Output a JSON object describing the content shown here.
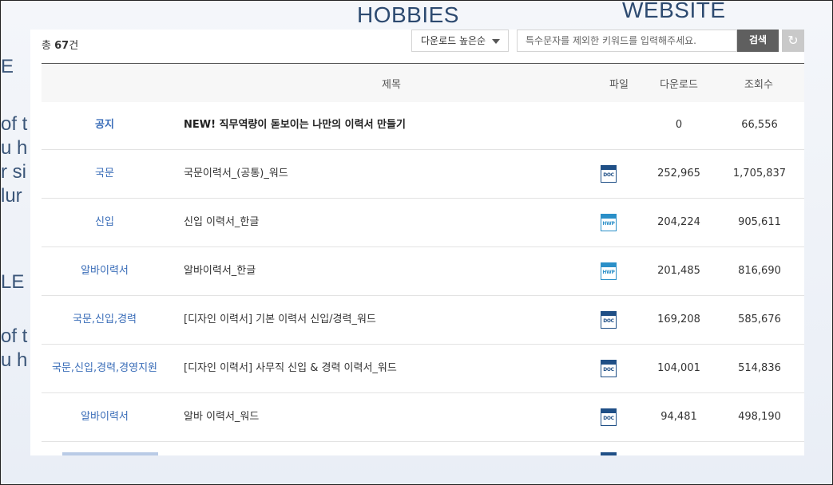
{
  "background": {
    "hobbies": "HOBBIES",
    "website": "WEBSITE",
    "left_fragments": [
      "E",
      "of t\nu h\nr si\nlur",
      "LE",
      "of t\nu h"
    ]
  },
  "toolbar": {
    "total_prefix": "총 ",
    "total_count": "67",
    "total_suffix": "건",
    "sort_selected": "다운로드 높은순",
    "search_placeholder": "특수문자를 제외한 키워드를 입력해주세요.",
    "search_value": "",
    "search_button": "검색",
    "reset_icon": "refresh-icon"
  },
  "table": {
    "headers": {
      "title": "제목",
      "file": "파일",
      "downloads": "다운로드",
      "views": "조회수"
    },
    "rows": [
      {
        "category": "공지",
        "title": "NEW! 직무역량이 돋보이는 나만의 이력서 만들기",
        "file": "",
        "downloads": "0",
        "views": "66,556",
        "notice": true
      },
      {
        "category": "국문",
        "title": "국문이력서_(공통)_워드",
        "file": "DOC",
        "downloads": "252,965",
        "views": "1,705,837"
      },
      {
        "category": "신입",
        "title": "신입 이력서_한글",
        "file": "HWP",
        "downloads": "204,224",
        "views": "905,611"
      },
      {
        "category": "알바이력서",
        "title": "알바이력서_한글",
        "file": "HWP",
        "downloads": "201,485",
        "views": "816,690"
      },
      {
        "category": "국문,신입,경력",
        "title": "[디자인 이력서] 기본 이력서 신입/경력_워드",
        "file": "DOC",
        "downloads": "169,208",
        "views": "585,676"
      },
      {
        "category": "국문,신입,경력,경영지원",
        "title": "[디자인 이력서] 사무직 신입 & 경력 이력서_워드",
        "file": "DOC",
        "downloads": "104,001",
        "views": "514,836"
      },
      {
        "category": "알바이력서",
        "title": "알바 이력서_워드",
        "file": "DOC",
        "downloads": "94,481",
        "views": "498,190"
      }
    ]
  },
  "colors": {
    "category_link": "#3a6db8",
    "doc_icon": "#1f4f86",
    "hwp_icon": "#2a8fc8",
    "search_button": "#5f5f5f"
  }
}
